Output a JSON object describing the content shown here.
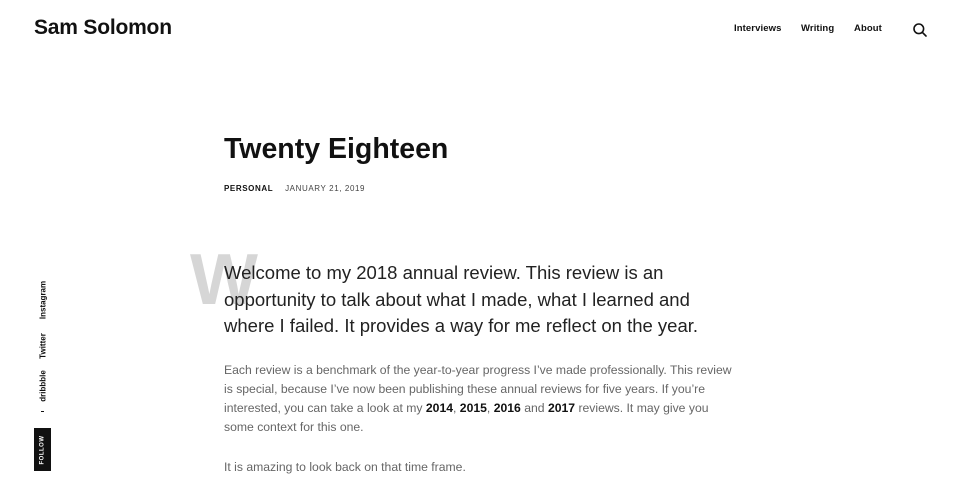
{
  "header": {
    "site_title": "Sam Solomon",
    "nav": [
      "Interviews",
      "Writing",
      "About"
    ],
    "search_icon": "search-icon"
  },
  "post": {
    "title": "Twenty Eighteen",
    "category": "PERSONAL",
    "date": "JANUARY 21, 2019",
    "dropcap": "W",
    "lead": "Welcome to my 2018 annual review. This review is an opportunity to talk about what I made, what I learned and where I failed. It provides a way for me reflect on the year.",
    "p1": {
      "text_a": "Each review is a benchmark of the year-to-year progress I’ve made professionally. This review is special, because I’ve now been publishing these annual reviews for five years. If you’re interested, you can take a look at my ",
      "link_2014": "2014",
      "sep1": ", ",
      "link_2015": "2015",
      "sep2": ", ",
      "link_2016": "2016",
      "sep3": " and ",
      "link_2017": "2017",
      "text_b": " reviews. It may give you some context for this one."
    },
    "p2": "It is amazing to look back on that time frame."
  },
  "sidebar": {
    "follow_label": "FOLLOW",
    "social": [
      "Instagram",
      "Twitter",
      "dribbble"
    ]
  }
}
